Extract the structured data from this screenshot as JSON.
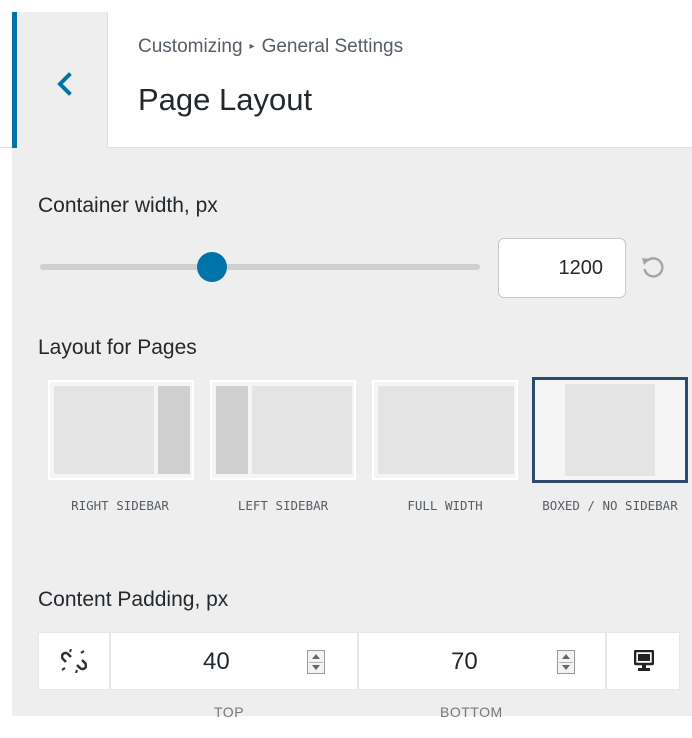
{
  "header": {
    "breadcrumb_root": "Customizing",
    "breadcrumb_separator": "▸",
    "breadcrumb_section": "General Settings",
    "title": "Page Layout",
    "accent_color": "#0073aa"
  },
  "container_width": {
    "label": "Container width, px",
    "value": "1200",
    "slider_fraction": 0.39
  },
  "layout": {
    "label": "Layout for Pages",
    "options": [
      {
        "caption": "RIGHT SIDEBAR",
        "selected": false
      },
      {
        "caption": "LEFT SIDEBAR",
        "selected": false
      },
      {
        "caption": "FULL WIDTH",
        "selected": false
      },
      {
        "caption": "BOXED / NO SIDEBAR",
        "selected": true
      }
    ]
  },
  "content_padding": {
    "label": "Content Padding, px",
    "top_value": "40",
    "bottom_value": "70",
    "top_caption": "TOP",
    "bottom_caption": "BOTTOM"
  }
}
